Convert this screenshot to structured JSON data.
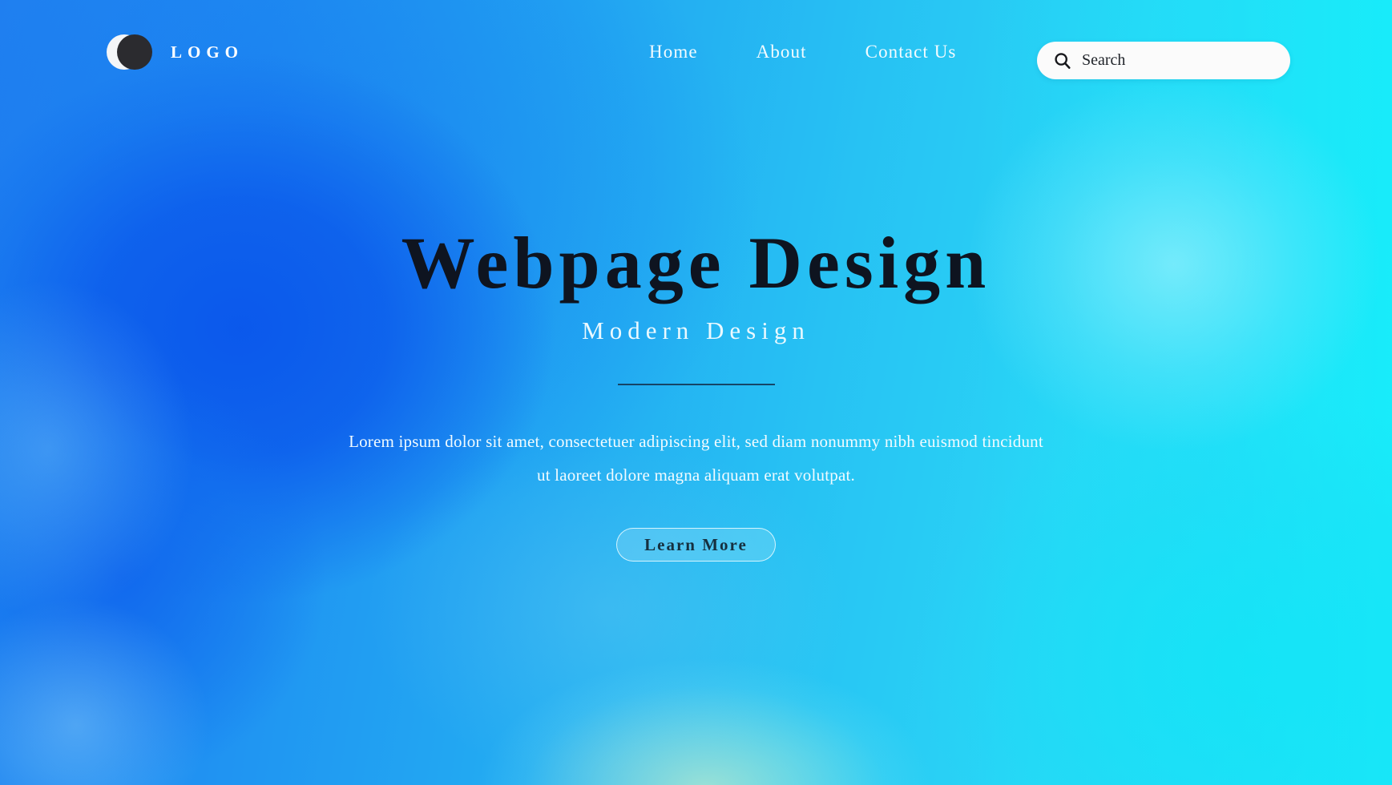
{
  "header": {
    "logo": {
      "icon_back": "circle-light-icon",
      "icon_front": "circle-dark-icon",
      "text": "LOGO"
    },
    "nav": [
      {
        "label": "Home"
      },
      {
        "label": "About"
      },
      {
        "label": "Contact Us"
      }
    ],
    "search": {
      "icon": "search-icon",
      "placeholder": "Search",
      "value": ""
    }
  },
  "hero": {
    "title": "Webpage Design",
    "subtitle": "Modern Design",
    "paragraph": "Lorem ipsum dolor sit amet, consectetuer adipiscing elit, sed diam nonummy nibh euismod tincidunt ut laoreet dolore magna aliquam erat volutpat.",
    "cta_label": "Learn More"
  },
  "colors": {
    "background_blue": "#1f7ff0",
    "background_cyan": "#2ce0f8",
    "deep_blue_blob": "#0a56eb",
    "title_text": "#0e1420",
    "light_text": "#f1fbff",
    "logo_dark": "#2b2b2f",
    "logo_light": "#f4f6f8",
    "search_background": "#fbfbfb",
    "divider": "#14314d",
    "warm_glow": "#e2f6c4"
  }
}
